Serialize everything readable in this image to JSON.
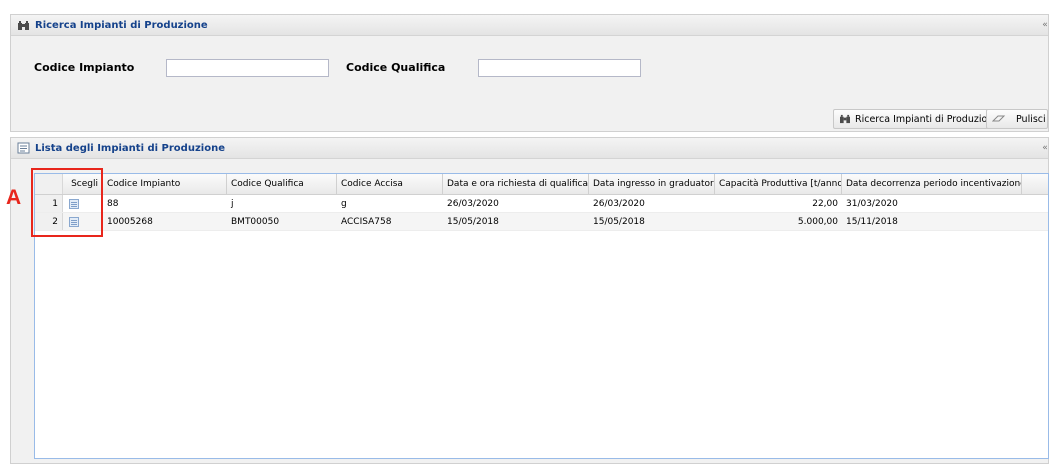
{
  "search_panel": {
    "title": "Ricerca Impianti di Produzione",
    "codice_impianto_label": "Codice Impianto",
    "codice_impianto_value": "",
    "codice_qualifica_label": "Codice Qualifica",
    "codice_qualifica_value": "",
    "search_button_label": "Ricerca Impianti di Produzione",
    "clear_button_label": "Pulisci"
  },
  "list_panel": {
    "title": "Lista degli Impianti di Produzione",
    "columns": {
      "scegli": "Scegli",
      "codice_impianto": "Codice Impianto",
      "codice_qualifica": "Codice Qualifica",
      "codice_accisa": "Codice Accisa",
      "data_richiesta": "Data e ora richiesta di qualifica",
      "data_ingresso": "Data ingresso in graduatoria",
      "capacita": "Capacità Produttiva [t/anno]",
      "data_decorrenza": "Data decorrenza periodo incentivazione"
    },
    "rows": [
      {
        "num": "1",
        "codice_impianto": "88",
        "codice_qualifica": "j",
        "codice_accisa": "g",
        "data_richiesta": "26/03/2020",
        "data_ingresso": "26/03/2020",
        "capacita": "22,00",
        "data_decorrenza": "31/03/2020"
      },
      {
        "num": "2",
        "codice_impianto": "10005268",
        "codice_qualifica": "BMT00050",
        "codice_accisa": "ACCISA758",
        "data_richiesta": "15/05/2018",
        "data_ingresso": "15/05/2018",
        "capacita": "5.000,00",
        "data_decorrenza": "15/11/2018"
      }
    ]
  },
  "annotation": {
    "letter": "A",
    "color": "#e8261c"
  }
}
